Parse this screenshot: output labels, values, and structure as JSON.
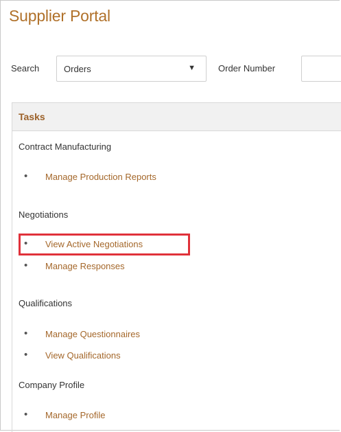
{
  "app": {
    "title": "Supplier Portal"
  },
  "search": {
    "label": "Search",
    "selected": "Orders",
    "caret": "▼",
    "order_number_label": "Order Number",
    "order_number_value": ""
  },
  "tasks": {
    "header": "Tasks",
    "sections": [
      {
        "heading": "Contract Manufacturing",
        "links": [
          "Manage Production Reports"
        ]
      },
      {
        "heading": "Negotiations",
        "links": [
          "View Active Negotiations",
          "Manage Responses"
        ]
      },
      {
        "heading": "Qualifications",
        "links": [
          "Manage Questionnaires",
          "View Qualifications"
        ]
      },
      {
        "heading": "Company Profile",
        "links": [
          "Manage Profile"
        ]
      }
    ]
  },
  "bullet": "•",
  "colors": {
    "title": "#b0712a",
    "link": "#a4672a",
    "tasks_header_text": "#9c6129",
    "highlight_box": "#e0313a"
  }
}
